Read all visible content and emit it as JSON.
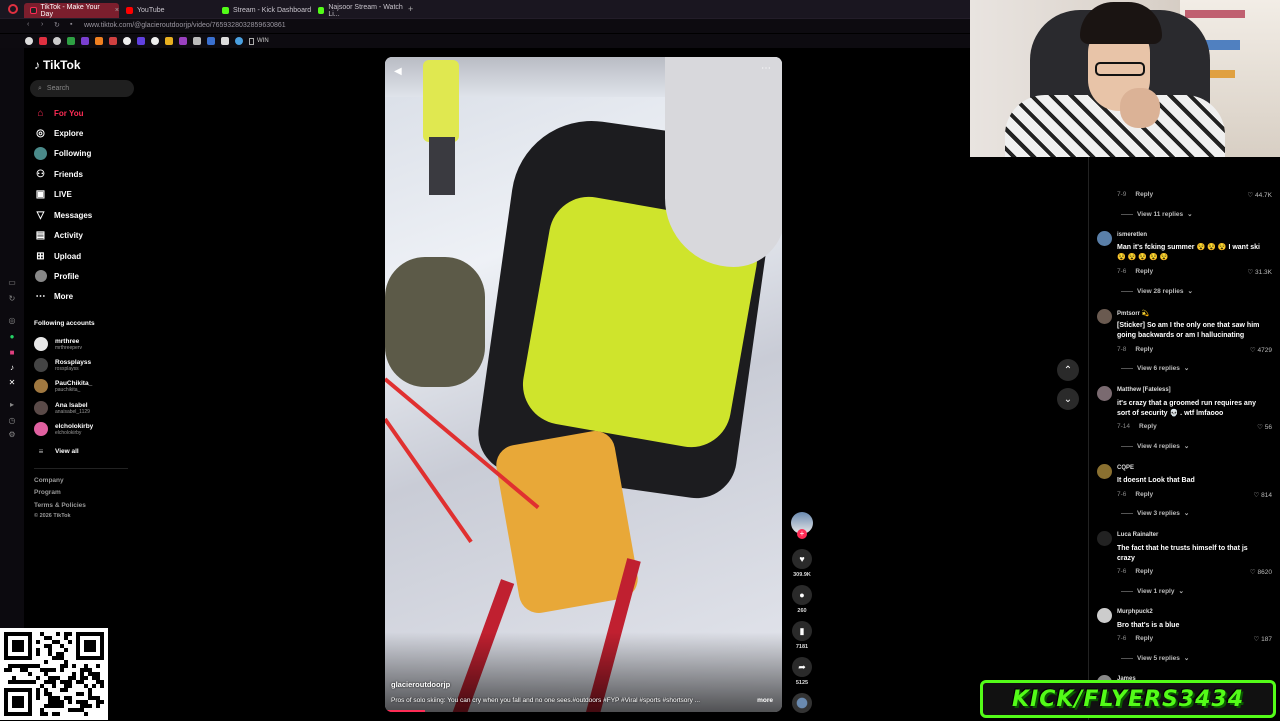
{
  "browser": {
    "tabs": [
      {
        "label": "TikTok - Make Your Day",
        "color": "#fe2c55"
      },
      {
        "label": "YouTube",
        "color": "#ff0000"
      },
      {
        "label": "Stream - Kick Dashboard",
        "color": "#53fc18"
      },
      {
        "label": "Najsoor Stream - Watch Li...",
        "color": "#53fc18"
      }
    ],
    "url": "www.tiktok.com/@glacieroutdoorjp/video/7659328032859630861",
    "bookmark_win": "WIN"
  },
  "sidebar": {
    "logo": "TikTok",
    "search_placeholder": "Search",
    "nav": [
      {
        "label": "For You",
        "icon": "home-icon"
      },
      {
        "label": "Explore",
        "icon": "compass-icon"
      },
      {
        "label": "Following",
        "icon": "avatar-icon"
      },
      {
        "label": "Friends",
        "icon": "friends-icon"
      },
      {
        "label": "LIVE",
        "icon": "live-icon"
      },
      {
        "label": "Messages",
        "icon": "send-icon"
      },
      {
        "label": "Activity",
        "icon": "inbox-icon"
      },
      {
        "label": "Upload",
        "icon": "plus-square-icon"
      },
      {
        "label": "Profile",
        "icon": "profile-icon"
      },
      {
        "label": "More",
        "icon": "ellipsis-icon"
      }
    ],
    "following_heading": "Following accounts",
    "following": [
      {
        "name": "mrthree",
        "handle": "mrthreeperv",
        "color": "#e8e8e8"
      },
      {
        "name": "Rossplayss",
        "handle": "rossplayss",
        "color": "#444"
      },
      {
        "name": "PauChikita_",
        "handle": "pauchikita_",
        "color": "#a07840"
      },
      {
        "name": "Ana Isabel",
        "handle": "anaisabel_1129",
        "color": "#5a4a48"
      },
      {
        "name": "elcholokirby",
        "handle": "elcholokirby",
        "color": "#e060a0"
      }
    ],
    "view_all": "View all",
    "footer": [
      "Company",
      "Program",
      "Terms & Policies",
      "© 2026 TikTok"
    ]
  },
  "video": {
    "username": "glacieroutdoorjp",
    "caption": "Pros of solo skiing: You can cry when you fall and no one sees.#outdoors #FYP #Viral #sports #shortsory ...",
    "more": "more",
    "progress": 0.1
  },
  "actions": {
    "likes": "309.9K",
    "comments": "260",
    "saves": "7181",
    "shares": "5125"
  },
  "comments": {
    "reply_label": "Reply",
    "items": [
      {
        "user": "",
        "text": "",
        "date": "7-9",
        "likes": "44.7K",
        "replies": "View 11 replies",
        "color": "#777"
      },
      {
        "user": "ismeretlen",
        "text": "Man it's fcking summer 😵 😵 😵 I want ski 😵 😵 😵 😵 😵",
        "date": "7-6",
        "likes": "31.3K",
        "replies": "View 28 replies",
        "color": "#5a7fa8"
      },
      {
        "user": "Pmtsorr 💫",
        "text": "[Sticker] So am I the only one that saw him going backwards or am I hallucinating",
        "date": "7-8",
        "likes": "4729",
        "replies": "View 6 replies",
        "color": "#6a5a50"
      },
      {
        "user": "Matthew [Fateless]",
        "text": "it's crazy that a groomed run requires any sort of security 💀 . wtf lmfaooo",
        "date": "7-14",
        "likes": "56",
        "replies": "View 4 replies",
        "color": "#7a6a70"
      },
      {
        "user": "CQPE",
        "text": "It doesnt Look that Bad",
        "date": "7-6",
        "likes": "814",
        "replies": "View 3 replies",
        "color": "#8a7030"
      },
      {
        "user": "Luca Rainalter",
        "text": "The fact that he trusts himself to that js crazy",
        "date": "7-6",
        "likes": "8620",
        "replies": "View 1 reply",
        "color": "#222"
      },
      {
        "user": "Murphpuck2",
        "text": "Bro that's is a blue",
        "date": "7-6",
        "likes": "187",
        "replies": "View 5 replies",
        "color": "#ccc"
      },
      {
        "user": "James",
        "text": "",
        "date": "",
        "likes": "",
        "replies": "",
        "color": "#888"
      }
    ]
  },
  "kick_banner": "KICK/FLYERS3434",
  "colors": {
    "accent": "#fe2c55",
    "kick_green": "#53fc18"
  }
}
